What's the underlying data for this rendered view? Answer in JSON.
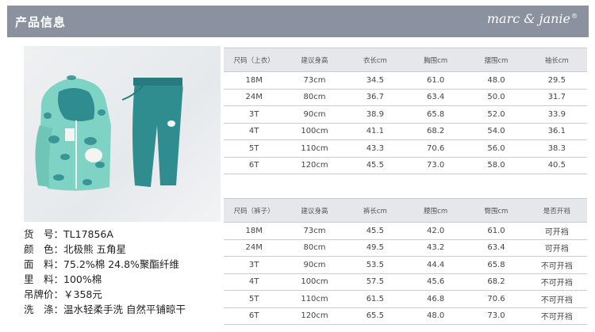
{
  "header": {
    "title": "产品信息",
    "brand": "marc & janie",
    "brand_mark": "®"
  },
  "product": {
    "rows": [
      {
        "label": "货　号：",
        "value": "TL17856A"
      },
      {
        "label": "颜　色：",
        "value": "北极熊 五角星"
      },
      {
        "label": "面　料：",
        "value": "75.2%棉 24.8%聚酯纤维"
      },
      {
        "label": "里　料：",
        "value": "100%棉"
      },
      {
        "label": "吊牌价：",
        "value": "￥358元"
      },
      {
        "label": "洗　涤：",
        "value": "温水轻柔手洗  自然平铺晾干"
      }
    ]
  },
  "top_table": {
    "headers": [
      "尺码（上衣）",
      "建议身高",
      "衣长cm",
      "胸围cm",
      "摆围cm",
      "袖长cm"
    ],
    "rows": [
      [
        "18M",
        "73cm",
        "34.5",
        "61.0",
        "48.0",
        "29.5"
      ],
      [
        "24M",
        "80cm",
        "36.7",
        "63.4",
        "50.0",
        "31.7"
      ],
      [
        "3T",
        "90cm",
        "38.9",
        "65.8",
        "52.0",
        "33.9"
      ],
      [
        "4T",
        "100cm",
        "41.1",
        "68.2",
        "54.0",
        "36.1"
      ],
      [
        "5T",
        "110cm",
        "43.3",
        "70.6",
        "56.0",
        "38.3"
      ],
      [
        "6T",
        "120cm",
        "45.5",
        "73.0",
        "58.0",
        "40.5"
      ]
    ]
  },
  "bottom_table": {
    "headers": [
      "尺码（裤子）",
      "建议身高",
      "裤长cm",
      "腰围cm",
      "臀围cm",
      "是否开裆"
    ],
    "rows": [
      [
        "18M",
        "73cm",
        "45.5",
        "42.0",
        "61.0",
        "可开裆"
      ],
      [
        "24M",
        "80cm",
        "49.5",
        "43.2",
        "63.4",
        "可开裆"
      ],
      [
        "3T",
        "90cm",
        "53.5",
        "44.4",
        "65.8",
        "不可开裆"
      ],
      [
        "4T",
        "100cm",
        "57.5",
        "45.6",
        "68.2",
        "不可开裆"
      ],
      [
        "5T",
        "110cm",
        "61.5",
        "46.8",
        "70.6",
        "不可开裆"
      ],
      [
        "6T",
        "120cm",
        "65.5",
        "48.0",
        "73.0",
        "不可开裆"
      ]
    ]
  },
  "colors": {
    "header_bg": "#8a919f",
    "table_header_bg": "#e5e7ea",
    "hoodie": "#7fd3c4",
    "pants": "#2f8c8f"
  }
}
